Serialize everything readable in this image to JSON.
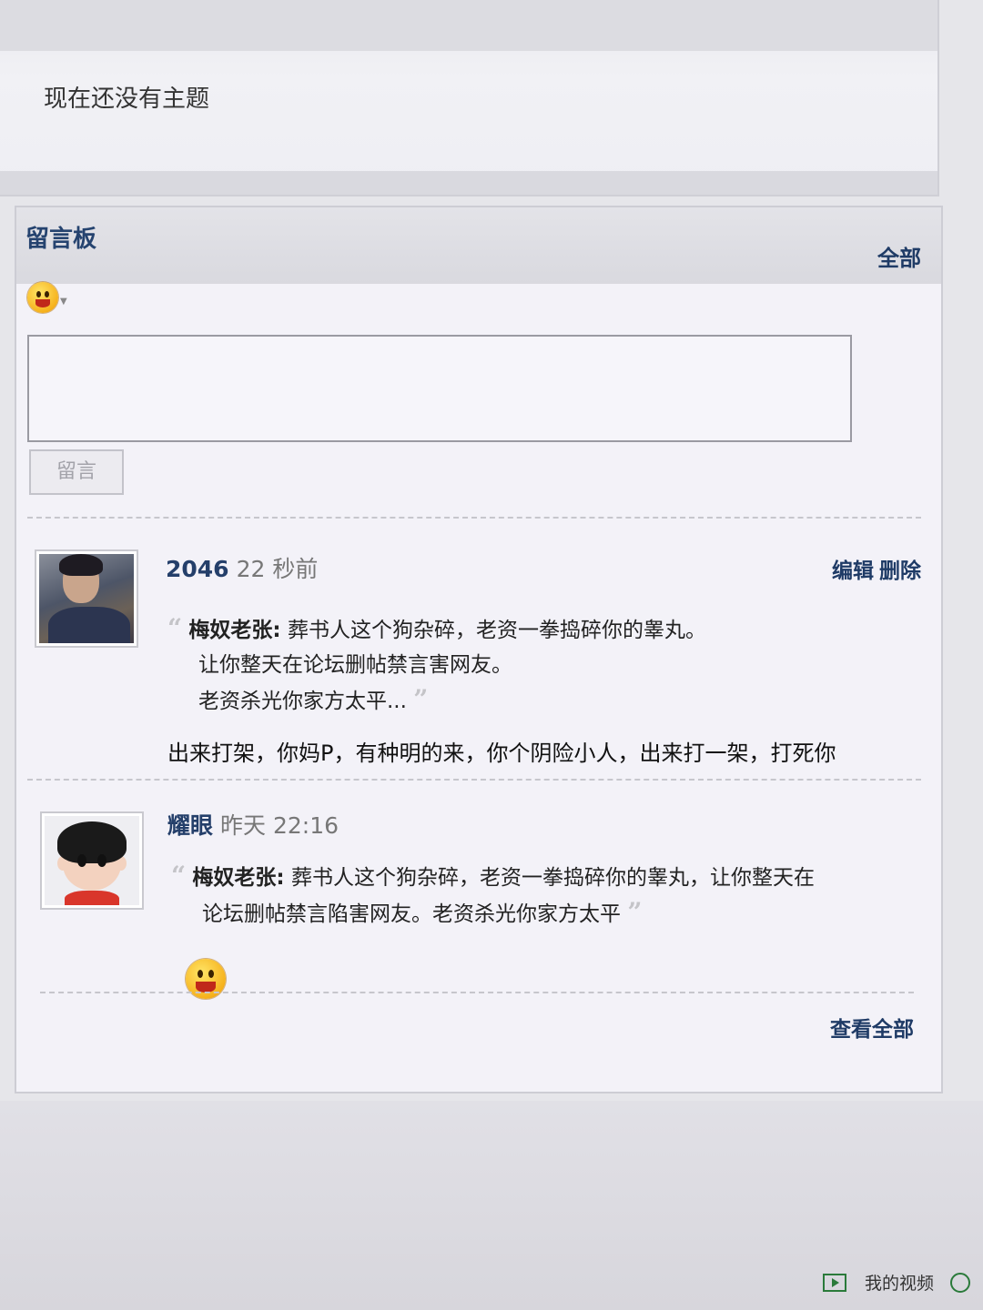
{
  "topic": {
    "title": "现在还没有主题"
  },
  "board": {
    "title": "留言板",
    "all_link": "全部",
    "emoji_icon": "smiley-face-icon",
    "textarea_value": "",
    "submit_label": "留言",
    "view_all": "查看全部",
    "messages": [
      {
        "author": "2046",
        "time": "22 秒前",
        "actions": {
          "edit": "编辑",
          "delete": "删除"
        },
        "avatar": "user-photo-avatar",
        "quote_author": "梅奴老张:",
        "quote_lines": [
          "葬书人这个狗杂碎，老资一拳捣碎你的睾丸。",
          "让你整天在论坛删帖禁言害网友。",
          "老资杀光你家方太平..."
        ],
        "reply": "出来打架，你妈P，有种明的来，你个阴险小人，出来打一架，打死你"
      },
      {
        "author": "耀眼",
        "time": "昨天 22:16",
        "avatar": "cartoon-avatar",
        "quote_author": "梅奴老张:",
        "quote_lines": [
          "葬书人这个狗杂碎，老资一拳捣碎你的睾丸，让你整天在",
          "论坛删帖禁言陷害网友。老资杀光你家方太平"
        ],
        "reply_emoji": "laughing-smiley-icon"
      }
    ]
  },
  "taskbar": {
    "video_label": "我的视频"
  },
  "colors": {
    "link": "#1f3b66",
    "author": "#243f6a",
    "panel": "#f3f2f8"
  }
}
